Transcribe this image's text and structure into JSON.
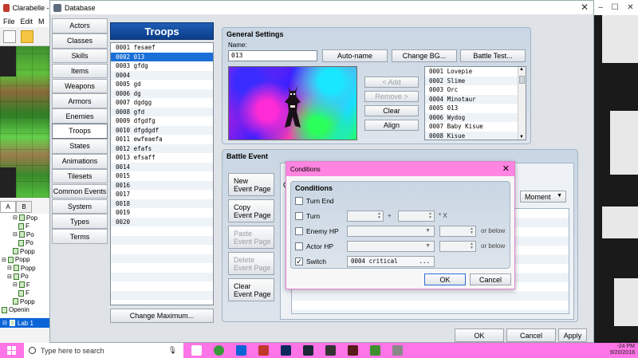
{
  "bg_app": {
    "title": "Clarabelle - R",
    "menu": [
      "File",
      "Edit",
      "M"
    ],
    "tabs": [
      "A",
      "B"
    ],
    "tree": [
      {
        "indent": 2,
        "label": "Pop",
        "toggle": "⊟"
      },
      {
        "indent": 3,
        "label": "F",
        "toggle": ""
      },
      {
        "indent": 2,
        "label": "Po",
        "toggle": "⊟"
      },
      {
        "indent": 3,
        "label": "Po",
        "toggle": ""
      },
      {
        "indent": 2,
        "label": "Popp",
        "toggle": ""
      },
      {
        "indent": 0,
        "label": "Popp",
        "toggle": "⊟"
      },
      {
        "indent": 1,
        "label": "Popp",
        "toggle": "⊟"
      },
      {
        "indent": 1,
        "label": "Po",
        "toggle": "⊟"
      },
      {
        "indent": 2,
        "label": "F",
        "toggle": "⊟"
      },
      {
        "indent": 3,
        "label": "F",
        "toggle": ""
      },
      {
        "indent": 2,
        "label": "Popp",
        "toggle": ""
      },
      {
        "indent": 0,
        "label": "Openin",
        "toggle": ""
      }
    ],
    "selected_node": "Lab 1"
  },
  "db": {
    "window_title": "Database",
    "categories": [
      "Actors",
      "Classes",
      "Skills",
      "Items",
      "Weapons",
      "Armors",
      "Enemies",
      "Troops",
      "States",
      "Animations",
      "Tilesets",
      "Common Events",
      "System",
      "Types",
      "Terms"
    ],
    "active_category": "Troops",
    "troops_header": "Troops",
    "troops": [
      "0001 fesaef",
      "0002 013",
      "0003 gfdg",
      "0004",
      "0005 gd",
      "0006 dg",
      "0007 dgdgg",
      "0008 gfd",
      "0009 dfgdfg",
      "0010 dfgdgdf",
      "0011 ewfeaefa",
      "0012 efafs",
      "0013 efsaff",
      "0014",
      "0015",
      "0016",
      "0017",
      "0018",
      "0019",
      "0020",
      "",
      "",
      "",
      "",
      "",
      "",
      "",
      "",
      ""
    ],
    "selected_troop_index": 1,
    "change_maximum": "Change Maximum...",
    "general": {
      "title": "General Settings",
      "name_label": "Name:",
      "name_value": "013",
      "auto_name": "Auto-name",
      "change_bg": "Change BG...",
      "battle_test": "Battle Test...",
      "add": "< Add",
      "remove": "Remove >",
      "clear": "Clear",
      "align": "Align",
      "enemies": [
        "0001 Lovepie",
        "0002 Slime",
        "0003 Orc",
        "0004 Minotaur",
        "0005 013",
        "0006 Wydog",
        "0007 Baby Kisue",
        "0008 Kisue"
      ]
    },
    "battle_event": {
      "title": "Battle Event",
      "new_page": [
        "New",
        "Event Page"
      ],
      "copy_page": [
        "Copy",
        "Event Page"
      ],
      "paste_page": [
        "Paste",
        "Event Page"
      ],
      "delete_page": [
        "Delete",
        "Event Page"
      ],
      "clear_page": [
        "Clear",
        "Event Page"
      ],
      "conditions_label": "C",
      "span": "Moment"
    },
    "ok": "OK",
    "cancel": "Cancel",
    "apply": "Apply"
  },
  "dialog": {
    "title": "Conditions",
    "group_title": "Conditions",
    "turn_end": "Turn End",
    "turn": "Turn",
    "turn_plus": "+",
    "turn_x": "* X",
    "enemy_hp": "Enemy HP",
    "actor_hp": "Actor HP",
    "or_below": "or below",
    "switch": "Switch",
    "switch_value": "0004 critical",
    "switch_checked": "✓",
    "ellipsis": "...",
    "ok": "OK",
    "cancel": "Cancel"
  },
  "taskbar": {
    "search_placeholder": "Type here to search",
    "time": "-24 PM",
    "date": "9/20/2018"
  },
  "colors": {
    "taskbar": "#ff74e6",
    "dialog_title": "#ff85e0",
    "selection": "#1a6fd6",
    "troops_header": "#1f5eb5"
  }
}
